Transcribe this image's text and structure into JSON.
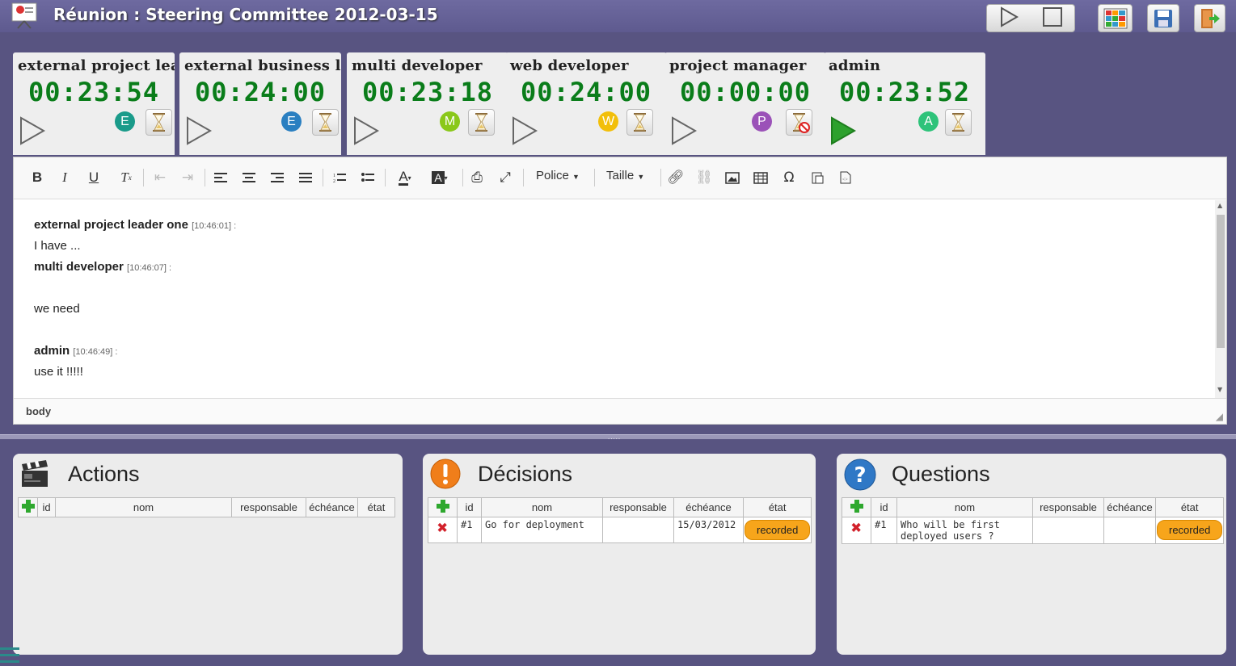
{
  "header": {
    "title": "Réunion : Steering Committee 2012-03-15"
  },
  "participants": [
    {
      "name": "external project lead",
      "time": "00:23:54",
      "initial": "E",
      "color": "#1a9b8a",
      "playing": false,
      "hourglass": "hourglass-icon"
    },
    {
      "name": "external business lea",
      "time": "00:24:00",
      "initial": "E",
      "color": "#2a7fc1",
      "playing": false,
      "hourglass": "hourglass-icon"
    },
    {
      "name": "multi developer",
      "time": "00:23:18",
      "initial": "M",
      "color": "#8ac81a",
      "playing": false,
      "hourglass": "hourglass-icon"
    },
    {
      "name": "web developer",
      "time": "00:24:00",
      "initial": "W",
      "color": "#f2bf0a",
      "playing": false,
      "hourglass": "hourglass-icon"
    },
    {
      "name": "project manager",
      "time": "00:00:00",
      "initial": "P",
      "color": "#9b52b8",
      "playing": false,
      "hourglass": "hourglass-disabled-icon"
    },
    {
      "name": "admin",
      "time": "00:23:52",
      "initial": "A",
      "color": "#2ec37a",
      "playing": true,
      "hourglass": "hourglass-icon"
    }
  ],
  "editor": {
    "font_label": "Police",
    "size_label": "Taille",
    "statusbar": "body",
    "lines": [
      {
        "author": "external project leader one",
        "time": "[10:46:01]",
        "sep": " :"
      },
      {
        "text": "I have ..."
      },
      {
        "author": "multi developer",
        "time": "[10:46:07]",
        "sep": " :"
      },
      {
        "text": ""
      },
      {
        "text": "we need"
      },
      {
        "text": ""
      },
      {
        "author": "admin",
        "time": "[10:46:49]",
        "sep": " :"
      },
      {
        "text": "use it !!!!!"
      }
    ]
  },
  "columns": [
    "id",
    "nom",
    "responsable",
    "échéance",
    "état"
  ],
  "panels": {
    "actions": {
      "title": "Actions",
      "rows": []
    },
    "decisions": {
      "title": "Décisions",
      "rows": [
        {
          "id": "#1",
          "nom": "Go for deployment",
          "responsable": "",
          "echeance": "15/03/2012",
          "etat": "recorded"
        }
      ]
    },
    "questions": {
      "title": "Questions",
      "rows": [
        {
          "id": "#1",
          "nom": "Who will be first deployed users ?",
          "responsable": "",
          "echeance": "",
          "etat": "recorded"
        }
      ]
    }
  }
}
